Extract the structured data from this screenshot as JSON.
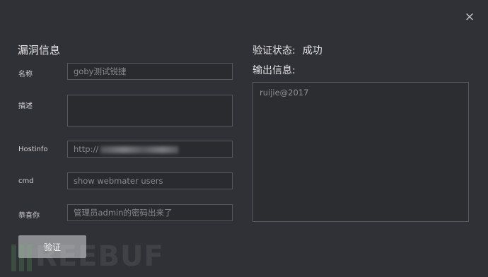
{
  "dialog": {
    "close_glyph": "×",
    "section_title": "漏洞信息",
    "fields": [
      {
        "label": "名称",
        "value": "goby测试锐捷"
      },
      {
        "label": "描述",
        "value": ""
      },
      {
        "label": "Hostinfo",
        "value": "http://"
      },
      {
        "label": "cmd",
        "value": "show webmater users"
      },
      {
        "label": "恭喜你",
        "value": "管理员admin的密码出来了"
      }
    ],
    "verify_button": "验证",
    "status_label": "验证状态:",
    "status_value": "成功",
    "output_label": "输出信息:",
    "output_text": "ruijie@2017"
  },
  "watermark": {
    "text": "REEBUF"
  },
  "colors": {
    "background": "#303136",
    "border": "#56585e",
    "button": "#8b8d91",
    "text": "#d8d8d8"
  }
}
